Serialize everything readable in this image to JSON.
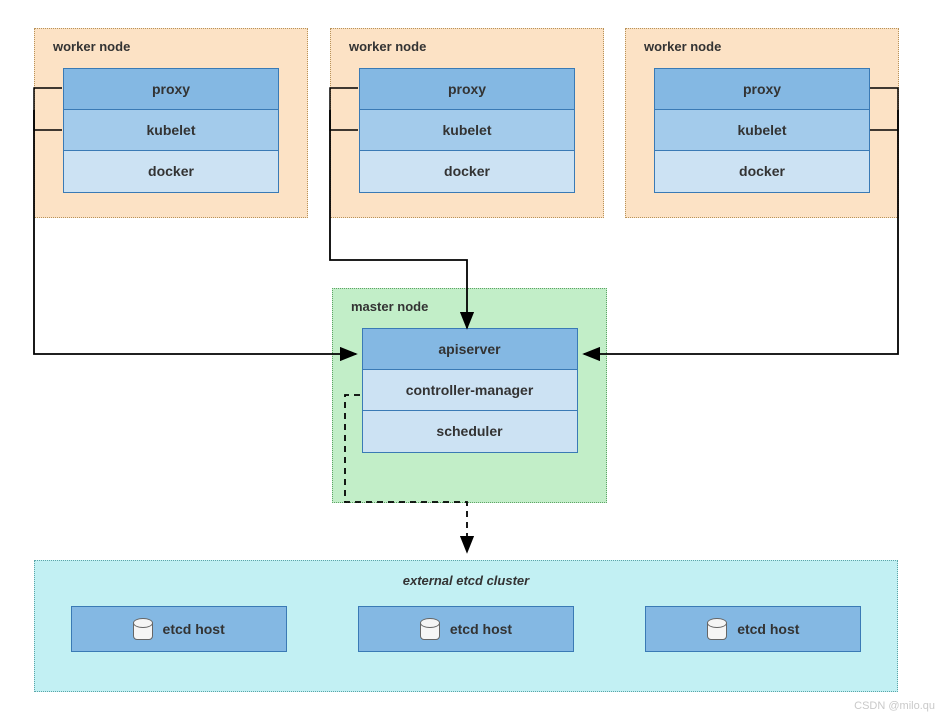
{
  "worker_nodes": [
    {
      "title": "worker node",
      "proxy": "proxy",
      "kubelet": "kubelet",
      "docker": "docker"
    },
    {
      "title": "worker node",
      "proxy": "proxy",
      "kubelet": "kubelet",
      "docker": "docker"
    },
    {
      "title": "worker node",
      "proxy": "proxy",
      "kubelet": "kubelet",
      "docker": "docker"
    }
  ],
  "master": {
    "title": "master node",
    "apiserver": "apiserver",
    "controller": "controller-manager",
    "scheduler": "scheduler"
  },
  "etcd": {
    "title": "external etcd cluster",
    "hosts": [
      "etcd host",
      "etcd host",
      "etcd host"
    ]
  },
  "watermark": "CSDN @milo.qu"
}
